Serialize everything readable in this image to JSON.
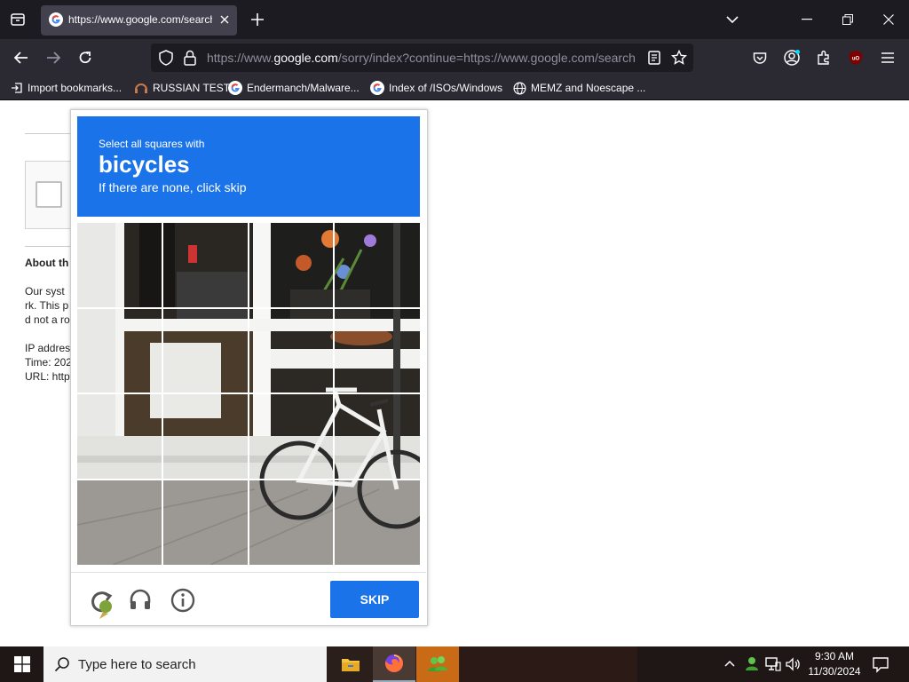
{
  "browser": {
    "tab": {
      "title": "https://www.google.com/search",
      "favicon": "google-g-icon"
    },
    "url": {
      "prefix": "https://www.",
      "domain": "google.com",
      "rest": "/sorry/index?continue=https://www.google.com/search"
    },
    "accent": "#1c1b22",
    "bookmarks": [
      {
        "label": "Import bookmarks...",
        "icon": "import-icon"
      },
      {
        "label": "RUSSIAN TEST",
        "icon": "headset-icon"
      },
      {
        "label": "Endermanch/Malware...",
        "icon": "google-g-icon"
      },
      {
        "label": "Index of /ISOs/Windows",
        "icon": "google-g-icon"
      },
      {
        "label": "MEMZ and Noescape ...",
        "icon": "globe-icon"
      }
    ]
  },
  "page": {
    "about_heading": "About th",
    "lines": [
      "Our syst",
      "rk. This p",
      "d not a ro"
    ],
    "ip": "IP addres",
    "time": "Time: 202",
    "url": "URL: http"
  },
  "captcha": {
    "instruction": "Select all squares with",
    "target": "bicycles",
    "hint": "If there are none, click skip",
    "skip_label": "SKIP",
    "header_color": "#1a73e8",
    "grid_size": 4
  },
  "taskbar": {
    "search_placeholder": "Type here to search",
    "time": "9:30 AM",
    "date": "11/30/2024"
  }
}
